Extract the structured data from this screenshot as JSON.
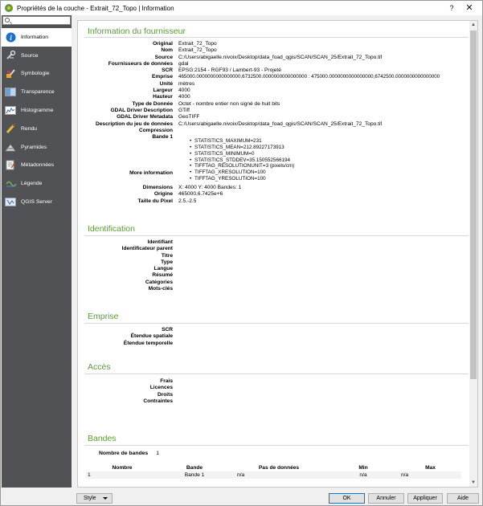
{
  "window": {
    "title": "Propriétés de la couche - Extrait_72_Topo | Information",
    "help": "?",
    "close": "✕"
  },
  "search": {
    "placeholder": ""
  },
  "sidebar": {
    "items": [
      {
        "label": "Information",
        "icon": "info-icon"
      },
      {
        "label": "Source",
        "icon": "wrench-icon"
      },
      {
        "label": "Symbologie",
        "icon": "paintbrush-icon"
      },
      {
        "label": "Transparence",
        "icon": "transparency-icon"
      },
      {
        "label": "Histogramme",
        "icon": "histogram-icon"
      },
      {
        "label": "Rendu",
        "icon": "brush-icon"
      },
      {
        "label": "Pyramides",
        "icon": "pyramid-icon"
      },
      {
        "label": "Métadonnées",
        "icon": "metadata-icon"
      },
      {
        "label": "Légende",
        "icon": "legend-icon"
      },
      {
        "label": "QGIS Server",
        "icon": "server-icon"
      }
    ]
  },
  "provider": {
    "title": "Information du fournisseur",
    "rows": [
      {
        "key": "Original",
        "value": "Extrait_72_Topo"
      },
      {
        "key": "Nom",
        "value": "Extrait_72_Topo"
      },
      {
        "key": "Source",
        "value": "C:/Users/abigaelle.nivoix/Desktop/data_foad_qgis/SCAN/SCAN_25/Extrait_72_Topo.tif"
      },
      {
        "key": "Fournisseurs de données",
        "value": "gdal"
      },
      {
        "key": "SCR",
        "value": "EPSG:2154 - RGF93 / Lambert-93 - Projeté"
      },
      {
        "key": "Emprise",
        "value": "465000.0000000000000000,6732500.0000000000000000 : 475000.0000000000000000,6742500.0000000000000000"
      },
      {
        "key": "Unité",
        "value": "mètres"
      },
      {
        "key": "Largeur",
        "value": "4000"
      },
      {
        "key": "Hauteur",
        "value": "4000"
      },
      {
        "key": "Type de Donnée",
        "value": "Octet - nombre entier non signé de huit bits"
      },
      {
        "key": "GDAL Driver Description",
        "value": "GTiff"
      },
      {
        "key": "GDAL Driver Metadata",
        "value": "GeoTIFF"
      },
      {
        "key": "Description du jeu de données",
        "value": "C:/Users/abigaelle.nivoix/Desktop/data_foad_qgis/SCAN/SCAN_25/Extrait_72_Topo.tif"
      },
      {
        "key": "Compression",
        "value": ""
      }
    ],
    "band1_key": "Bande 1",
    "band1": [
      "STATISTICS_MAXIMUM=231",
      "STATISTICS_MEAN=212.89227173913",
      "STATISTICS_MINIMUM=0",
      "STATISTICS_STDDEV=35.150552566194"
    ],
    "more_key": "More information",
    "more": [
      "TIFFTAG_RESOLUTIONUNIT=3 (pixels/cm)",
      "TIFFTAG_XRESOLUTION=100",
      "TIFFTAG_YRESOLUTION=100"
    ],
    "rows2": [
      {
        "key": "Dimensions",
        "value": "X: 4000 Y: 4000 Bandes: 1"
      },
      {
        "key": "Origine",
        "value": "465000,6.7425e+6"
      },
      {
        "key": "Taille du Pixel",
        "value": "2.5,-2.5"
      }
    ]
  },
  "identification": {
    "title": "Identification",
    "rows": [
      {
        "key": "Identifiant",
        "value": ""
      },
      {
        "key": "Identificateur parent",
        "value": ""
      },
      {
        "key": "Titre",
        "value": ""
      },
      {
        "key": "Type",
        "value": ""
      },
      {
        "key": "Langue",
        "value": ""
      },
      {
        "key": "Résumé",
        "value": ""
      },
      {
        "key": "Catégories",
        "value": ""
      },
      {
        "key": "Mots-clés",
        "value": ""
      }
    ]
  },
  "emprise": {
    "title": "Emprise",
    "rows": [
      {
        "key": "SCR",
        "value": ""
      },
      {
        "key": "Étendue spatiale",
        "value": ""
      },
      {
        "key": "Étendue temporelle",
        "value": ""
      }
    ]
  },
  "acces": {
    "title": "Accès",
    "rows": [
      {
        "key": "Frais",
        "value": ""
      },
      {
        "key": "Licences",
        "value": ""
      },
      {
        "key": "Droits",
        "value": ""
      },
      {
        "key": "Contraintes",
        "value": ""
      }
    ]
  },
  "bandes": {
    "title": "Bandes",
    "count_label": "Nombre de bandes",
    "count_value": "1",
    "headers": [
      "Nombre",
      "Bande",
      "Pas de données",
      "Min",
      "Max"
    ],
    "rows": [
      [
        "1",
        "Bande 1",
        "n/a",
        "n/a",
        "n/a"
      ]
    ]
  },
  "footer": {
    "style": "Style",
    "ok": "OK",
    "cancel": "Annuler",
    "apply": "Appliquer",
    "help": "Aide"
  },
  "colors": {
    "accent": "#5a9a3a",
    "sidebar": "#505255",
    "info": "#1e6fc8"
  }
}
